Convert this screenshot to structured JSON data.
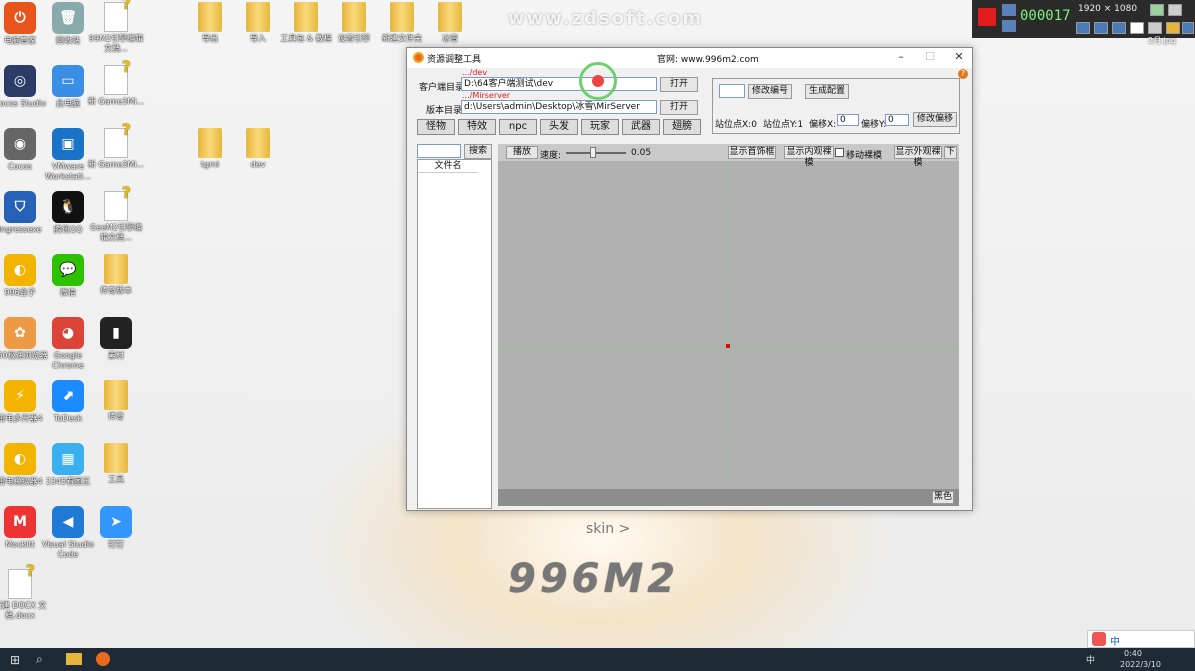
{
  "watermark": "www.zdsoft.com",
  "desktop_icons": [
    {
      "label": "电脑管家",
      "color": "#e9541c",
      "glyph": "⏻"
    },
    {
      "label": "回收站",
      "color": "#8aa",
      "glyph": "🗑"
    },
    {
      "label": "99M2引擎编辑文档...",
      "type": "doc"
    },
    {
      "label": "Cocos Studio",
      "color": "#2b3d66",
      "glyph": "◎"
    },
    {
      "label": "此电脑",
      "color": "#3a8ee6",
      "glyph": "▭"
    },
    {
      "label": "新 Game3Mi...",
      "type": "doc"
    },
    {
      "label": "Cocos",
      "color": "#666",
      "glyph": "◉"
    },
    {
      "label": "VMware Workstati...",
      "color": "#1a73c7",
      "glyph": "▣"
    },
    {
      "label": "新 Game3Mi...",
      "type": "doc"
    },
    {
      "label": "Ingressexe",
      "color": "#2461b7",
      "glyph": "⛉"
    },
    {
      "label": "腾讯QQ",
      "color": "#111",
      "glyph": "🐧"
    },
    {
      "label": "GeeM2引擎编辑文档...",
      "type": "doc"
    },
    {
      "label": "996盒子",
      "color": "#f2b400",
      "glyph": "◐"
    },
    {
      "label": "微信",
      "color": "#2dc100",
      "glyph": "💬"
    },
    {
      "label": "传奇版本",
      "type": "folder"
    },
    {
      "label": "360极速浏览器",
      "color": "#e94",
      "glyph": "✿"
    },
    {
      "label": "Google Chrome",
      "color": "#db4437",
      "glyph": "◕"
    },
    {
      "label": "素材",
      "color": "#222",
      "glyph": "▮"
    },
    {
      "label": "雷电多开器4",
      "color": "#f2b400",
      "glyph": "⚡"
    },
    {
      "label": "ToDesk",
      "color": "#1a8cff",
      "glyph": "⬈"
    },
    {
      "label": "传奇",
      "type": "folder"
    },
    {
      "label": "雷电模拟器4",
      "color": "#f2b400",
      "glyph": "◐"
    },
    {
      "label": "2345看图王",
      "color": "#3ab0f0",
      "glyph": "▦"
    },
    {
      "label": "工具",
      "type": "folder"
    },
    {
      "label": "MockItt",
      "color": "#e33",
      "glyph": "M"
    },
    {
      "label": "Visual Studio Code",
      "color": "#1f7ad6",
      "glyph": "◀"
    },
    {
      "label": "钉钉",
      "color": "#3296fa",
      "glyph": "➤"
    },
    {
      "label": "新建 DOCX 文档.docx",
      "type": "doc"
    }
  ],
  "top_folders": [
    {
      "label": "导出"
    },
    {
      "label": "导入"
    },
    {
      "label": "工具包 & 教程"
    },
    {
      "label": "设置引擎"
    },
    {
      "label": "新建文件夹"
    },
    {
      "label": "冰雪"
    }
  ],
  "mid_folders": [
    {
      "label": "tgml"
    },
    {
      "label": "dev"
    }
  ],
  "recorder": {
    "counter": "000017",
    "resolution": "1920 × 1080",
    "label_right": "2月.jpg"
  },
  "app": {
    "title": "资源调整工具",
    "website": "官网: www.996m2.com",
    "client_dir_label": "客户端目录:",
    "client_dir_hint": ".../dev",
    "client_dir_value": "D:\\64客户端测试\\dev",
    "server_dir_label": "版本目录:",
    "server_dir_hint": ".../Mirserver",
    "server_dir_value": "d:\\Users\\admin\\Desktop\\冰雪\\MirServer",
    "open_label": "打开",
    "tabs": [
      "怪物",
      "特效",
      "npc",
      "头发",
      "玩家",
      "武器",
      "翅膀"
    ],
    "modify_id_label": "修改编号",
    "gen_config_label": "生成配置",
    "stand_x_label": "站位点X:",
    "stand_x_value": "0",
    "stand_y_label": "站位点Y:",
    "stand_y_value": "1",
    "offset_x_label": "偏移X:",
    "offset_x_value": "0",
    "offset_y_label": "偏移Y:",
    "offset_y_value": "0",
    "modify_offset_label": "修改偏移",
    "search_label": "搜索",
    "file_col": "文件名",
    "play_label": "播放",
    "speed_label": "速度:",
    "speed_value": "0.05",
    "show_first_frame": "显示首饰框",
    "show_inner": "显示内观裸模",
    "move_model": "移动裸模",
    "show_outer": "显示外观裸模",
    "down_label": "下",
    "black_label": "黑色"
  },
  "skin_text": "skin >",
  "logo_text": "996M2",
  "tray": {
    "time": "0:40",
    "date": "2022/3/10",
    "ime": "中"
  }
}
